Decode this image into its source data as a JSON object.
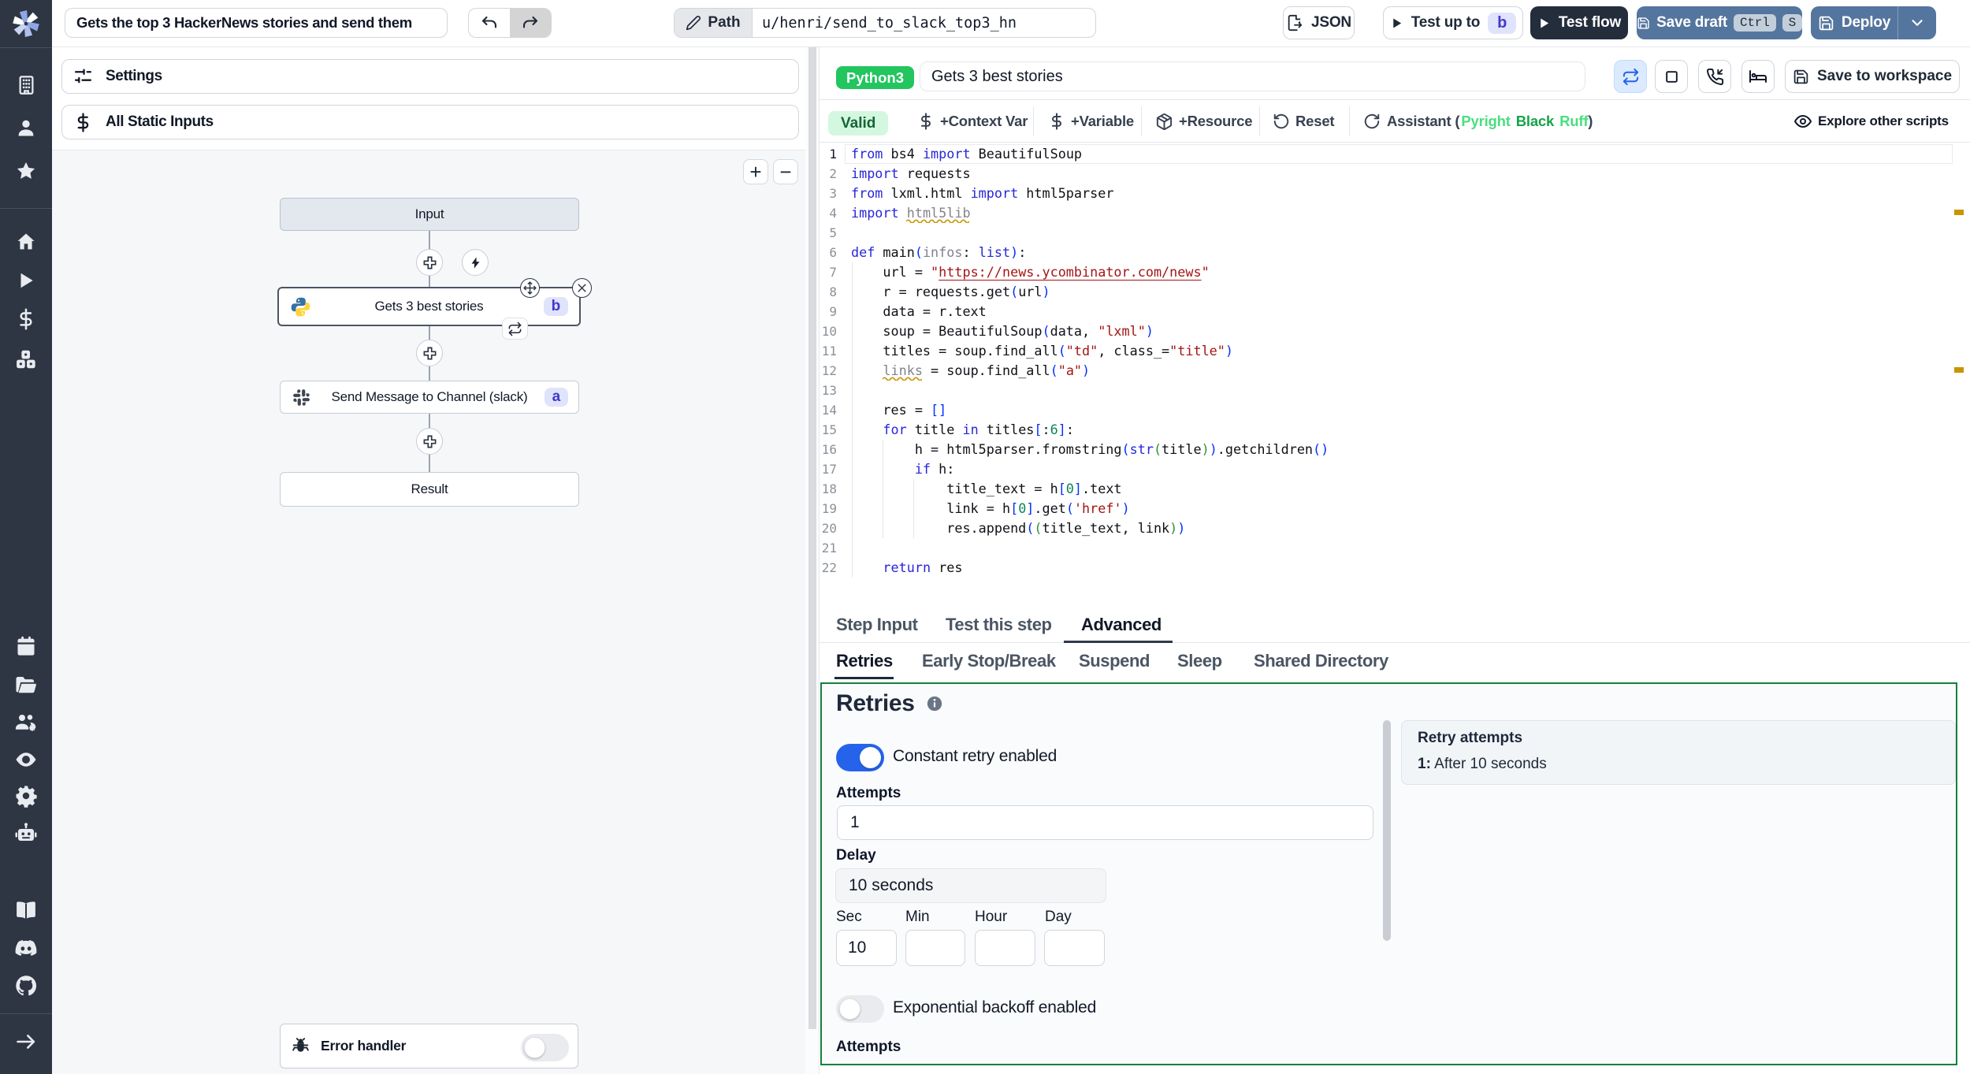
{
  "topbar": {
    "flow_name": "Gets the top 3 HackerNews stories and send them",
    "path_label": "Path",
    "path_value": "u/henri/send_to_slack_top3_hn",
    "json_button": "JSON",
    "test_up_to": "Test up to",
    "test_up_to_badge": "b",
    "test_flow": "Test flow",
    "save_draft": "Save draft",
    "save_draft_key1": "Ctrl",
    "save_draft_key2": "S",
    "deploy": "Deploy"
  },
  "flow_panel": {
    "settings": "Settings",
    "static_inputs": "All Static Inputs",
    "zoom_in": "+",
    "zoom_out": "−",
    "input_node": "Input",
    "step_b_label": "Gets 3 best stories",
    "step_b_badge": "b",
    "step_a_label": "Send Message to Channel (slack)",
    "step_a_badge": "a",
    "result_node": "Result",
    "error_handler": "Error handler"
  },
  "editor_header": {
    "lang_badge": "Python3",
    "step_name": "Gets 3 best stories",
    "save_to_workspace": "Save to workspace",
    "valid_badge": "Valid",
    "context_var": "+Context Var",
    "variable": "+Variable",
    "resource": "+Resource",
    "reset": "Reset",
    "assistant_prefix": "Assistant (",
    "assistant_pyright": "Pyright",
    "assistant_black": "Black",
    "assistant_ruff": "Ruff",
    "assistant_suffix": ")",
    "explore": "Explore other scripts"
  },
  "code": {
    "language": "python",
    "lines": [
      [
        [
          "k",
          "from"
        ],
        [
          "t",
          " bs4 "
        ],
        [
          "k",
          "import"
        ],
        [
          "t",
          " BeautifulSoup"
        ]
      ],
      [
        [
          "k",
          "import"
        ],
        [
          "t",
          " requests"
        ]
      ],
      [
        [
          "k",
          "from"
        ],
        [
          "t",
          " lxml.html "
        ],
        [
          "k",
          "import"
        ],
        [
          "t",
          " html5parser"
        ]
      ],
      [
        [
          "k",
          "import"
        ],
        [
          "t",
          " "
        ],
        [
          "g",
          "html5lib"
        ]
      ],
      [],
      [
        [
          "k",
          "def"
        ],
        [
          "t",
          " main"
        ],
        [
          "b1",
          "("
        ],
        [
          "g",
          "infos"
        ],
        [
          "t",
          ": "
        ],
        [
          "k",
          "list"
        ],
        [
          "b1",
          ")"
        ],
        [
          "t",
          ":"
        ]
      ],
      [
        [
          "t",
          "    url = "
        ],
        [
          "s",
          "\""
        ],
        [
          "u",
          "https://news.ycombinator.com/news"
        ],
        [
          "s",
          "\""
        ]
      ],
      [
        [
          "t",
          "    r = requests.get"
        ],
        [
          "b1",
          "("
        ],
        [
          "t",
          "url"
        ],
        [
          "b1",
          ")"
        ]
      ],
      [
        [
          "t",
          "    data = r.text"
        ]
      ],
      [
        [
          "t",
          "    soup = BeautifulSoup"
        ],
        [
          "b1",
          "("
        ],
        [
          "t",
          "data, "
        ],
        [
          "s",
          "\"lxml\""
        ],
        [
          "b1",
          ")"
        ]
      ],
      [
        [
          "t",
          "    titles = soup.find_all"
        ],
        [
          "b1",
          "("
        ],
        [
          "s",
          "\"td\""
        ],
        [
          "t",
          ", class_="
        ],
        [
          "s",
          "\"title\""
        ],
        [
          "b1",
          ")"
        ]
      ],
      [
        [
          "t",
          "    "
        ],
        [
          "g",
          "links"
        ],
        [
          "t",
          " = soup.find_all"
        ],
        [
          "b1",
          "("
        ],
        [
          "s",
          "\"a\""
        ],
        [
          "b1",
          ")"
        ]
      ],
      [],
      [
        [
          "t",
          "    res = "
        ],
        [
          "b1",
          "[]"
        ]
      ],
      [
        [
          "t",
          "    "
        ],
        [
          "k",
          "for"
        ],
        [
          "t",
          " title "
        ],
        [
          "k",
          "in"
        ],
        [
          "t",
          " titles"
        ],
        [
          "b1",
          "["
        ],
        [
          "t",
          ":"
        ],
        [
          "n",
          "6"
        ],
        [
          "b1",
          "]"
        ],
        [
          "t",
          ":"
        ]
      ],
      [
        [
          "t",
          "        h = html5parser.fromstring"
        ],
        [
          "b1",
          "("
        ],
        [
          "k",
          "str"
        ],
        [
          "b2",
          "("
        ],
        [
          "t",
          "title"
        ],
        [
          "b2",
          ")"
        ],
        [
          "b1",
          ")"
        ],
        [
          "t",
          ".getchildren"
        ],
        [
          "b1",
          "()"
        ]
      ],
      [
        [
          "t",
          "        "
        ],
        [
          "k",
          "if"
        ],
        [
          "t",
          " h:"
        ]
      ],
      [
        [
          "t",
          "            title_text = h"
        ],
        [
          "b1",
          "["
        ],
        [
          "n",
          "0"
        ],
        [
          "b1",
          "]"
        ],
        [
          "t",
          ".text"
        ]
      ],
      [
        [
          "t",
          "            link = h"
        ],
        [
          "b1",
          "["
        ],
        [
          "n",
          "0"
        ],
        [
          "b1",
          "]"
        ],
        [
          "t",
          ".get"
        ],
        [
          "b1",
          "("
        ],
        [
          "s",
          "'href'"
        ],
        [
          "b1",
          ")"
        ]
      ],
      [
        [
          "t",
          "            res.append"
        ],
        [
          "b1",
          "("
        ],
        [
          "b2",
          "("
        ],
        [
          "t",
          "title_text, link"
        ],
        [
          "b2",
          ")"
        ],
        [
          "b1",
          ")"
        ]
      ],
      [],
      [
        [
          "t",
          "    "
        ],
        [
          "k",
          "return"
        ],
        [
          "t",
          " res"
        ]
      ]
    ]
  },
  "tabs": {
    "step_input": "Step Input",
    "test_this_step": "Test this step",
    "advanced": "Advanced",
    "retries": "Retries",
    "early_stop": "Early Stop/Break",
    "suspend": "Suspend",
    "sleep": "Sleep",
    "shared_directory": "Shared Directory"
  },
  "retries": {
    "title": "Retries",
    "constant_label": "Constant retry enabled",
    "attempts_label": "Attempts",
    "attempts_value": "1",
    "delay_label": "Delay",
    "delay_value": "10 seconds",
    "sec_label": "Sec",
    "min_label": "Min",
    "hour_label": "Hour",
    "day_label": "Day",
    "sec_value": "10",
    "expo_label": "Exponential backoff enabled",
    "attempts2_label": "Attempts",
    "preview_title": "Retry attempts",
    "preview_num": "1:",
    "preview_text": "After 10 seconds"
  }
}
